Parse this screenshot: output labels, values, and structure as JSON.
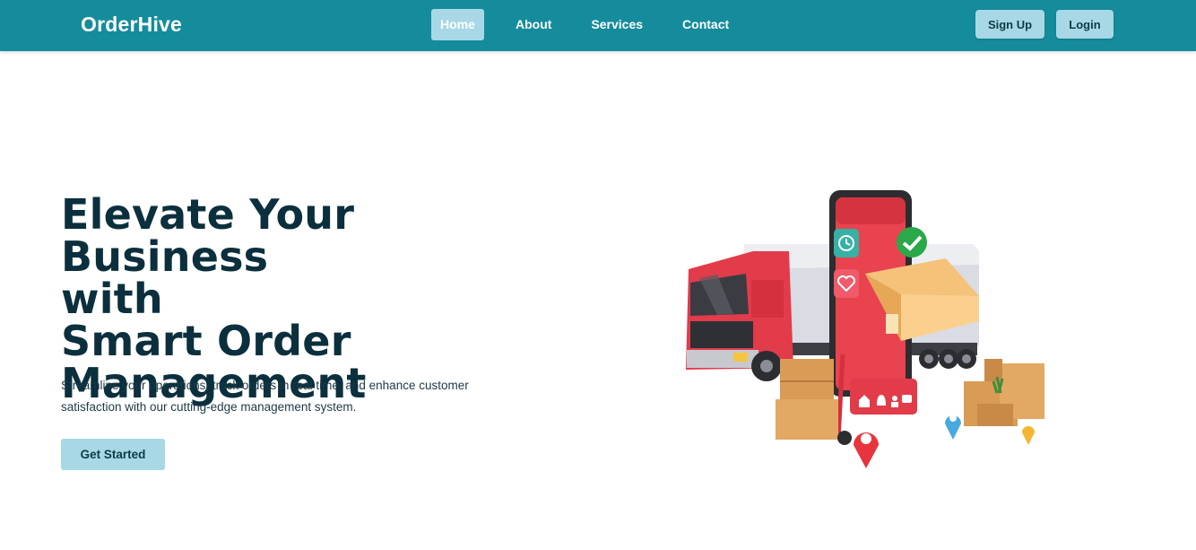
{
  "nav": {
    "brand": "OrderHive",
    "links": [
      "Home",
      "About",
      "Services",
      "Contact"
    ],
    "signup_label": "Sign Up",
    "login_label": "Login"
  },
  "hero": {
    "title_lines": [
      "Elevate Your Business",
      "with",
      "Smart Order",
      "Management"
    ],
    "subtitle_line1": "Streamline your operations, track orders in real time, and enhance customer",
    "subtitle_line2": "satisfaction with our cutting-edge management system.",
    "cta_label": "Get Started"
  },
  "colors": {
    "navbar": "#148c9c",
    "accent_button": "#a8d8e6",
    "heading": "#0b2f3d"
  },
  "illustration": {
    "subject": "delivery-truck-with-phone-and-packages",
    "icons": [
      "clock-icon",
      "heart-icon",
      "check-badge-icon",
      "location-pin-icon",
      "home-icon",
      "bell-icon",
      "user-icon",
      "chat-icon"
    ]
  }
}
